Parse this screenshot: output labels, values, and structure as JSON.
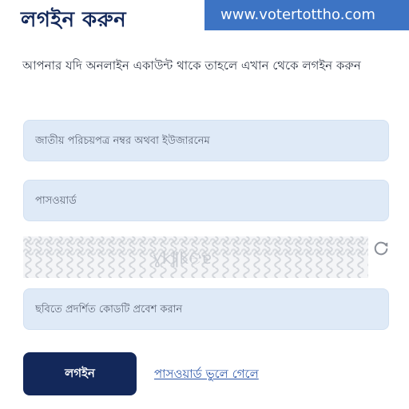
{
  "header": {
    "title": "লগইন করুন",
    "watermark": "www.votertottho.com"
  },
  "intro": {
    "text": "আপনার যদি অনলাইন একাউন্ট থাকে তাহলে এখান থেকে লগইন করুন"
  },
  "form": {
    "nid_placeholder": "জাতীয় পরিচয়পত্র নম্বর অথবা ইউজারনেম",
    "password_placeholder": "পাসওয়ার্ড",
    "captcha_placeholder": "ছবিতে প্রদর্শিত কোডটি প্রবেশ করান",
    "captcha_image_alt": "captcha code image",
    "login_label": "লগইন",
    "forgot_label": "পাসওয়ার্ড ভুলে গেলে"
  },
  "colors": {
    "primary": "#13285a",
    "field_bg": "#dfeaf7",
    "link": "#2a55a8",
    "watermark_bg": "#3d74c4"
  },
  "icons": {
    "refresh": "refresh-icon"
  }
}
